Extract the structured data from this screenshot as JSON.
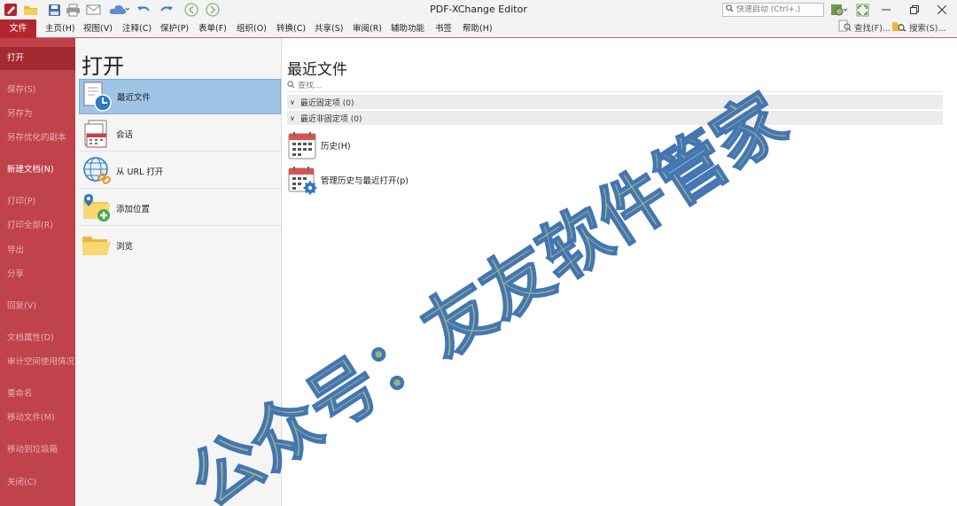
{
  "app": {
    "title": "PDF-XChange Editor"
  },
  "quick_launch": {
    "placeholder": "快速启动 (Ctrl+.)"
  },
  "menu": {
    "file": "文件",
    "tabs": [
      "主页(H)",
      "视图(V)",
      "注释(C)",
      "保护(P)",
      "表单(F)",
      "组织(O)",
      "转换(C)",
      "共享(S)",
      "审阅(R)",
      "辅助功能",
      "书签",
      "帮助(H)"
    ],
    "find": "查找(F)...",
    "search": "搜索(S)..."
  },
  "backstage_nav": [
    "打开",
    "保存(S)",
    "另存为",
    "另存优化的副本",
    "新建文档(N)",
    "打印(P)",
    "打印全部(R)",
    "导出",
    "分享",
    "回复(V)",
    "文档属性(D)",
    "审计空间使用情况",
    "重命名",
    "移动文件(M)",
    "移动到垃圾箱",
    "关闭(C)"
  ],
  "open_panel": {
    "title": "打开",
    "sources": [
      "最近文件",
      "会话",
      "从 URL 打开",
      "添加位置",
      "浏览"
    ]
  },
  "recent": {
    "title": "最近文件",
    "search_placeholder": "查找...",
    "pinned_group": "最近固定项 (0)",
    "unpinned_group": "最近非固定项 (0)",
    "items": [
      "历史(H)",
      "管理历史与最近打开(p)"
    ]
  },
  "watermark": "公众号：友友软件管家",
  "colors": {
    "accent": "#b3262e",
    "nav_bg": "#c0434b",
    "selection": "#9fc4e6"
  }
}
